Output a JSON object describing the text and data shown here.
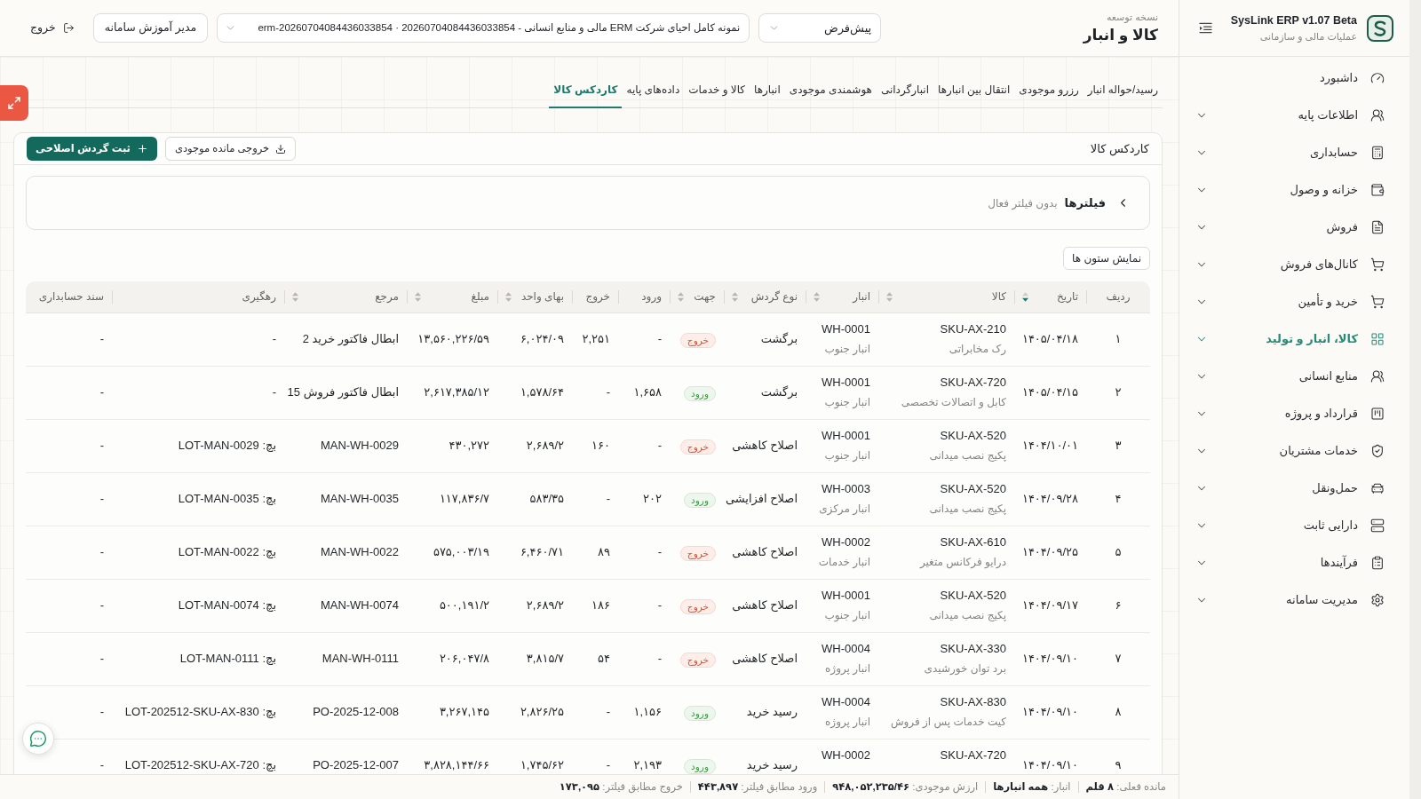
{
  "sidebar": {
    "brand": {
      "title": "SysLink ERP v1.07 Beta",
      "subtitle": "عملیات مالی و سازمانی"
    },
    "items": [
      {
        "label": "داشبورد",
        "kind": "link",
        "selected": false
      },
      {
        "label": "اطلاعات پایه",
        "kind": "group",
        "selected": false
      },
      {
        "label": "حسابداری",
        "kind": "group",
        "selected": false
      },
      {
        "label": "خزانه و وصول",
        "kind": "group",
        "selected": false
      },
      {
        "label": "فروش",
        "kind": "group",
        "selected": false
      },
      {
        "label": "کانال‌های فروش",
        "kind": "group",
        "selected": false
      },
      {
        "label": "خرید و تأمین",
        "kind": "group",
        "selected": false
      },
      {
        "label": "کالا، انبار و تولید",
        "kind": "group",
        "selected": true
      },
      {
        "label": "منابع انسانی",
        "kind": "group",
        "selected": false
      },
      {
        "label": "قرارداد و پروژه",
        "kind": "group",
        "selected": false
      },
      {
        "label": "خدمات مشتریان",
        "kind": "group",
        "selected": false
      },
      {
        "label": "حمل‌ونقل",
        "kind": "group",
        "selected": false
      },
      {
        "label": "دارایی ثابت",
        "kind": "group",
        "selected": false
      },
      {
        "label": "فرآیندها",
        "kind": "group",
        "selected": false
      },
      {
        "label": "مدیریت سامانه",
        "kind": "group",
        "selected": false
      }
    ]
  },
  "header": {
    "caption": "نسخه توسعه",
    "title": "کالا و انبار",
    "profile_select": {
      "value": "پیش‌فرض"
    },
    "company_select": {
      "value": "نمونه کامل احیای شرکت ERM مالی و منابع انسانی - 20260704084436033854 · erm-20260704084436033854"
    },
    "help_button": {
      "label": "مدیر آموزش سامانه"
    },
    "logout_button": {
      "label": "خروج"
    }
  },
  "tabs": [
    {
      "label": "رسید/حواله انبار",
      "selected": false
    },
    {
      "label": "رزرو موجودی",
      "selected": false
    },
    {
      "label": "انتقال بین انبارها",
      "selected": false
    },
    {
      "label": "انبارگردانی",
      "selected": false
    },
    {
      "label": "هوشمندی موجودی",
      "selected": false
    },
    {
      "label": "انبارها",
      "selected": false
    },
    {
      "label": "کالا و خدمات",
      "selected": false
    },
    {
      "label": "داده‌های پایه",
      "selected": false
    },
    {
      "label": "کاردکس کالا",
      "selected": true
    }
  ],
  "card": {
    "title": "کاردکس کالا",
    "actions": [
      {
        "label": "خروجی مانده موجودی",
        "kind": "export"
      },
      {
        "label": "ثبت گردش اصلاحی",
        "kind": "add"
      }
    ]
  },
  "filters": {
    "label": "فیلترها",
    "summary": "بدون فیلتر فعال",
    "expanded": false
  },
  "columns_button": {
    "label": "نمایش ستون ها"
  },
  "table": {
    "columns": [
      {
        "label": "ردیف",
        "sortable": false
      },
      {
        "label": "تاریخ",
        "sortable": true,
        "sorted": true
      },
      {
        "label": "کالا",
        "sortable": true,
        "sorted": false
      },
      {
        "label": "انبار",
        "sortable": true,
        "sorted": false
      },
      {
        "label": "نوع گردش",
        "sortable": true,
        "sorted": false
      },
      {
        "label": "جهت",
        "sortable": true,
        "sorted": false
      },
      {
        "label": "ورود",
        "sortable": false
      },
      {
        "label": "خروج",
        "sortable": false
      },
      {
        "label": "بهای واحد",
        "sortable": true,
        "sorted": false
      },
      {
        "label": "مبلغ",
        "sortable": true,
        "sorted": false
      },
      {
        "label": "مرجع",
        "sortable": true,
        "sorted": false
      },
      {
        "label": "رهگیری",
        "sortable": false
      },
      {
        "label": "سند حسابداری",
        "sortable": false
      }
    ],
    "rows": [
      {
        "index": "۱",
        "date": "۱۴۰۵/۰۴/۱۸",
        "item": {
          "sku": "SKU-AX-210",
          "name": "رک مخابراتی"
        },
        "warehouse": {
          "code": "WH-0001",
          "name": "انبار جنوب"
        },
        "movement": "برگشت",
        "direction": {
          "label": "خروج",
          "kind": "out"
        },
        "in": "-",
        "out": "۲,۲۵۱",
        "unit_price": "۶,۰۲۴/۰۹",
        "amount": "۱۳,۵۶۰,۲۲۶/۵۹",
        "reference": "ابطال فاکتور خرید 2",
        "tracking": "-",
        "voucher": "-"
      },
      {
        "index": "۲",
        "date": "۱۴۰۵/۰۴/۱۵",
        "item": {
          "sku": "SKU-AX-720",
          "name": "کابل و اتصالات تخصصی"
        },
        "warehouse": {
          "code": "WH-0001",
          "name": "انبار جنوب"
        },
        "movement": "برگشت",
        "direction": {
          "label": "ورود",
          "kind": "in"
        },
        "in": "۱,۶۵۸",
        "out": "-",
        "unit_price": "۱,۵۷۸/۶۴",
        "amount": "۲,۶۱۷,۳۸۵/۱۲",
        "reference": "ابطال فاکتور فروش 15",
        "tracking": "-",
        "voucher": "-"
      },
      {
        "index": "۳",
        "date": "۱۴۰۴/۱۰/۰۱",
        "item": {
          "sku": "SKU-AX-520",
          "name": "پکیج نصب میدانی"
        },
        "warehouse": {
          "code": "WH-0001",
          "name": "انبار جنوب"
        },
        "movement": "اصلاح کاهشی",
        "direction": {
          "label": "خروج",
          "kind": "out"
        },
        "in": "-",
        "out": "۱۶۰",
        "unit_price": "۲,۶۸۹/۲",
        "amount": "۴۳۰,۲۷۲",
        "reference": "MAN-WH-0029",
        "tracking": "بچ: LOT-MAN-0029",
        "voucher": "-"
      },
      {
        "index": "۴",
        "date": "۱۴۰۴/۰۹/۲۸",
        "item": {
          "sku": "SKU-AX-520",
          "name": "پکیج نصب میدانی"
        },
        "warehouse": {
          "code": "WH-0003",
          "name": "انبار مرکزی"
        },
        "movement": "اصلاح افزایشی",
        "direction": {
          "label": "ورود",
          "kind": "in"
        },
        "in": "۲۰۲",
        "out": "-",
        "unit_price": "۵۸۳/۳۵",
        "amount": "۱۱۷,۸۳۶/۷",
        "reference": "MAN-WH-0035",
        "tracking": "بچ: LOT-MAN-0035",
        "voucher": "-"
      },
      {
        "index": "۵",
        "date": "۱۴۰۴/۰۹/۲۵",
        "item": {
          "sku": "SKU-AX-610",
          "name": "درایو فرکانس متغیر"
        },
        "warehouse": {
          "code": "WH-0002",
          "name": "انبار خدمات"
        },
        "movement": "اصلاح کاهشی",
        "direction": {
          "label": "خروج",
          "kind": "out"
        },
        "in": "-",
        "out": "۸۹",
        "unit_price": "۶,۴۶۰/۷۱",
        "amount": "۵۷۵,۰۰۳/۱۹",
        "reference": "MAN-WH-0022",
        "tracking": "بچ: LOT-MAN-0022",
        "voucher": "-"
      },
      {
        "index": "۶",
        "date": "۱۴۰۴/۰۹/۱۷",
        "item": {
          "sku": "SKU-AX-520",
          "name": "پکیج نصب میدانی"
        },
        "warehouse": {
          "code": "WH-0001",
          "name": "انبار جنوب"
        },
        "movement": "اصلاح کاهشی",
        "direction": {
          "label": "خروج",
          "kind": "out"
        },
        "in": "-",
        "out": "۱۸۶",
        "unit_price": "۲,۶۸۹/۲",
        "amount": "۵۰۰,۱۹۱/۲",
        "reference": "MAN-WH-0074",
        "tracking": "بچ: LOT-MAN-0074",
        "voucher": "-"
      },
      {
        "index": "۷",
        "date": "۱۴۰۴/۰۹/۱۰",
        "item": {
          "sku": "SKU-AX-330",
          "name": "برد توان خورشیدی"
        },
        "warehouse": {
          "code": "WH-0004",
          "name": "انبار پروژه"
        },
        "movement": "اصلاح کاهشی",
        "direction": {
          "label": "خروج",
          "kind": "out"
        },
        "in": "-",
        "out": "۵۴",
        "unit_price": "۳,۸۱۵/۷",
        "amount": "۲۰۶,۰۴۷/۸",
        "reference": "MAN-WH-0111",
        "tracking": "بچ: LOT-MAN-0111",
        "voucher": "-"
      },
      {
        "index": "۸",
        "date": "۱۴۰۴/۰۹/۱۰",
        "item": {
          "sku": "SKU-AX-830",
          "name": "کیت خدمات پس از فروش"
        },
        "warehouse": {
          "code": "WH-0004",
          "name": "انبار پروژه"
        },
        "movement": "رسید خرید",
        "direction": {
          "label": "ورود",
          "kind": "in"
        },
        "in": "۱,۱۵۶",
        "out": "-",
        "unit_price": "۲,۸۲۶/۲۵",
        "amount": "۳,۲۶۷,۱۴۵",
        "reference": "PO-2025-12-008",
        "tracking": "بچ: LOT-202512-SKU-AX-830",
        "voucher": "-"
      },
      {
        "index": "۹",
        "date": "۱۴۰۴/۰۹/۱۰",
        "item": {
          "sku": "SKU-AX-720"
        },
        "warehouse": {
          "code": "WH-0002"
        },
        "movement": "رسید خرید",
        "direction": {
          "label": "ورود",
          "kind": "in"
        },
        "in": "۲,۱۹۳",
        "out": "-",
        "unit_price": "۱,۷۴۵/۶۲",
        "amount": "۳,۸۲۸,۱۴۴/۶۶",
        "reference": "PO-2025-12-007",
        "tracking": "بچ: LOT-202512-SKU-AX-720",
        "voucher": "-"
      }
    ]
  },
  "status_bar": {
    "items": [
      "مانده فعلی: **۸ قلم**",
      "انبار: **همه انبارها**",
      "ارزش موجودی: **۹۴۸,۰۵۲,۲۳۵/۴۶**",
      "ورود مطابق فیلتر: **۴۴۳,۸۹۷**",
      "خروج مطابق فیلتر: **۱۷۳,۰۹۵**"
    ]
  }
}
